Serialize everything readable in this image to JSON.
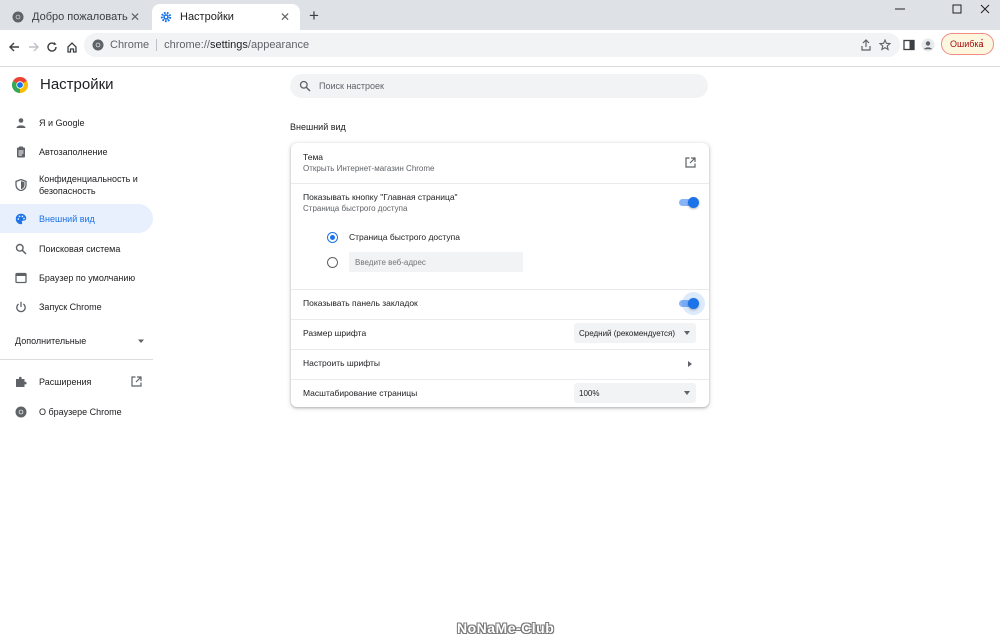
{
  "tabs": [
    {
      "title": "Добро пожаловать в Chrome!",
      "favicon": "chrome-icon",
      "active": false
    },
    {
      "title": "Настройки",
      "favicon": "settings-gear-icon",
      "active": true
    }
  ],
  "window_controls": {
    "minimize": "—",
    "maximize": "☐",
    "close": "✕"
  },
  "toolbar": {
    "site_chip": "Chrome",
    "url_scheme": "chrome://",
    "url_host": "settings",
    "url_path": "/appearance",
    "error_button": "Ошибка"
  },
  "sidebar": {
    "title": "Настройки",
    "items": [
      {
        "label": "Я и Google",
        "icon": "person-icon"
      },
      {
        "label": "Автозаполнение",
        "icon": "clipboard-icon"
      },
      {
        "label": "Конфиденциальность и безопасность",
        "icon": "shield-icon"
      },
      {
        "label": "Внешний вид",
        "icon": "palette-icon",
        "selected": true
      },
      {
        "label": "Поисковая система",
        "icon": "search-icon"
      },
      {
        "label": "Браузер по умолчанию",
        "icon": "browser-icon"
      },
      {
        "label": "Запуск Chrome",
        "icon": "power-icon"
      }
    ],
    "advanced": "Дополнительные",
    "extensions": "Расширения",
    "about": "О браузере Chrome"
  },
  "search": {
    "placeholder": "Поиск настроек"
  },
  "section_title": "Внешний вид",
  "appearance": {
    "theme_label": "Тема",
    "theme_sub": "Открыть Интернет-магазин Chrome",
    "home_label": "Показывать кнопку \"Главная страница\"",
    "home_sub": "Страница быстрого доступа",
    "home_enabled": true,
    "radio_ntp": "Страница быстрого доступа",
    "radio_url_placeholder": "Введите веб-адрес",
    "bookmarks_label": "Показывать панель закладок",
    "bookmarks_enabled": true,
    "font_size_label": "Размер шрифта",
    "font_size_value": "Средний (рекомендуется)",
    "customize_fonts_label": "Настроить шрифты",
    "zoom_label": "Масштабирование страницы",
    "zoom_value": "100%"
  },
  "colors": {
    "accent": "#1a73e8",
    "selected_bg": "#e8f0fe"
  },
  "watermark": "NoNaMe-Club"
}
